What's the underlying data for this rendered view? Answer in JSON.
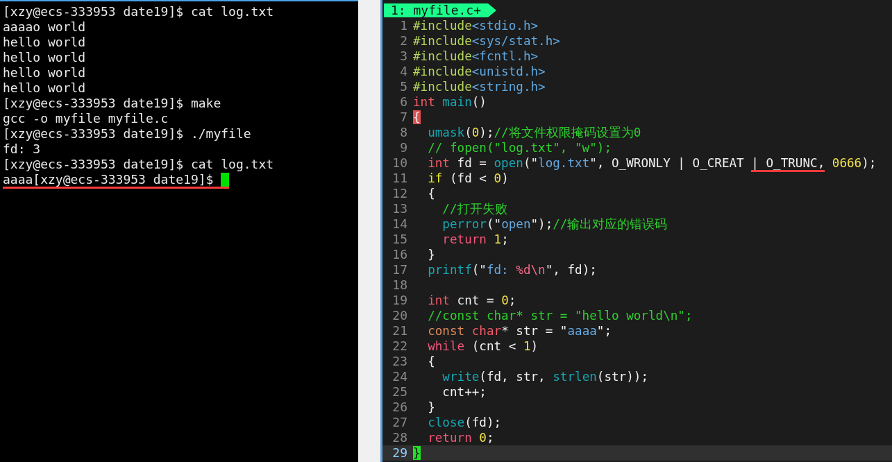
{
  "terminal": {
    "lines": [
      {
        "text": "[xzy@ecs-333953 date19]$ cat log.txt",
        "underlined": false,
        "cursor": false
      },
      {
        "text": "aaaao world",
        "underlined": false,
        "cursor": false
      },
      {
        "text": "hello world",
        "underlined": false,
        "cursor": false
      },
      {
        "text": "hello world",
        "underlined": false,
        "cursor": false
      },
      {
        "text": "hello world",
        "underlined": false,
        "cursor": false
      },
      {
        "text": "hello world",
        "underlined": false,
        "cursor": false
      },
      {
        "text": "[xzy@ecs-333953 date19]$ make",
        "underlined": false,
        "cursor": false
      },
      {
        "text": "gcc -o myfile myfile.c",
        "underlined": false,
        "cursor": false
      },
      {
        "text": "[xzy@ecs-333953 date19]$ ./myfile",
        "underlined": false,
        "cursor": false
      },
      {
        "text": "fd: 3",
        "underlined": false,
        "cursor": false
      },
      {
        "text": "[xzy@ecs-333953 date19]$ cat log.txt",
        "underlined": false,
        "cursor": false
      },
      {
        "text": "aaaa[xzy@ecs-333953 date19]$ ",
        "underlined": true,
        "cursor": true
      }
    ]
  },
  "editor": {
    "tabs": [
      {
        "label": "1: myfile.c+",
        "selected": true
      }
    ],
    "lines": [
      {
        "number": "1",
        "current": false,
        "tokens": [
          {
            "text": "#include",
            "kind": "preproc"
          },
          {
            "text": "<stdio.h>",
            "kind": "header"
          }
        ]
      },
      {
        "number": "2",
        "current": false,
        "tokens": [
          {
            "text": "#include",
            "kind": "preproc"
          },
          {
            "text": "<sys/stat.h>",
            "kind": "header"
          }
        ]
      },
      {
        "number": "3",
        "current": false,
        "tokens": [
          {
            "text": "#include",
            "kind": "preproc"
          },
          {
            "text": "<fcntl.h>",
            "kind": "header"
          }
        ]
      },
      {
        "number": "4",
        "current": false,
        "tokens": [
          {
            "text": "#include",
            "kind": "preproc"
          },
          {
            "text": "<unistd.h>",
            "kind": "header"
          }
        ]
      },
      {
        "number": "5",
        "current": false,
        "tokens": [
          {
            "text": "#include",
            "kind": "preproc"
          },
          {
            "text": "<string.h>",
            "kind": "header"
          }
        ]
      },
      {
        "number": "6",
        "current": false,
        "tokens": [
          {
            "text": "int",
            "kind": "type"
          },
          {
            "text": " main",
            "kind": "func"
          },
          {
            "text": "()",
            "kind": "plain"
          }
        ]
      },
      {
        "number": "7",
        "current": false,
        "tokens": [
          {
            "text": "{",
            "kind": "match"
          }
        ]
      },
      {
        "number": "8",
        "current": false,
        "tokens": [
          {
            "text": "  umask",
            "kind": "func"
          },
          {
            "text": "(",
            "kind": "plain"
          },
          {
            "text": "0",
            "kind": "number"
          },
          {
            "text": ");",
            "kind": "plain"
          },
          {
            "text": "//将文件权限掩码设置为0",
            "kind": "comment"
          }
        ]
      },
      {
        "number": "9",
        "current": false,
        "tokens": [
          {
            "text": "  // fopen(\"log.txt\", \"w\");",
            "kind": "comment"
          }
        ]
      },
      {
        "number": "10",
        "current": false,
        "tokens": [
          {
            "text": "  int",
            "kind": "type"
          },
          {
            "text": " fd = ",
            "kind": "plain"
          },
          {
            "text": "open",
            "kind": "func"
          },
          {
            "text": "(\"",
            "kind": "plain"
          },
          {
            "text": "log.txt",
            "kind": "string"
          },
          {
            "text": "\", O_WRONLY | O_CREAT ",
            "kind": "plain"
          },
          {
            "text": "| O_TRUNC,",
            "kind": "underlined"
          },
          {
            "text": " 0666",
            "kind": "number"
          },
          {
            "text": ");",
            "kind": "plain"
          }
        ]
      },
      {
        "number": "11",
        "current": false,
        "tokens": [
          {
            "text": "  if",
            "kind": "keyword"
          },
          {
            "text": " (fd < ",
            "kind": "plain"
          },
          {
            "text": "0",
            "kind": "number"
          },
          {
            "text": ")",
            "kind": "plain"
          }
        ]
      },
      {
        "number": "12",
        "current": false,
        "tokens": [
          {
            "text": "  {",
            "kind": "plain"
          }
        ]
      },
      {
        "number": "13",
        "current": false,
        "tokens": [
          {
            "text": "    //打开失败",
            "kind": "comment"
          }
        ]
      },
      {
        "number": "14",
        "current": false,
        "tokens": [
          {
            "text": "    perror",
            "kind": "func"
          },
          {
            "text": "(\"",
            "kind": "plain"
          },
          {
            "text": "open",
            "kind": "string"
          },
          {
            "text": "\");",
            "kind": "plain"
          },
          {
            "text": "//输出对应的错误码",
            "kind": "comment"
          }
        ]
      },
      {
        "number": "15",
        "current": false,
        "tokens": [
          {
            "text": "    return",
            "kind": "flow"
          },
          {
            "text": " 1",
            "kind": "number"
          },
          {
            "text": ";",
            "kind": "plain"
          }
        ]
      },
      {
        "number": "16",
        "current": false,
        "tokens": [
          {
            "text": "  }",
            "kind": "plain"
          }
        ]
      },
      {
        "number": "17",
        "current": false,
        "tokens": [
          {
            "text": "  printf",
            "kind": "func"
          },
          {
            "text": "(\"",
            "kind": "plain"
          },
          {
            "text": "fd: ",
            "kind": "string"
          },
          {
            "text": "%d\\n",
            "kind": "format"
          },
          {
            "text": "\", fd);",
            "kind": "plain"
          }
        ]
      },
      {
        "number": "18",
        "current": false
      },
      {
        "number": "19",
        "current": false,
        "tokens": [
          {
            "text": "  int",
            "kind": "type"
          },
          {
            "text": " cnt = ",
            "kind": "plain"
          },
          {
            "text": "0",
            "kind": "number"
          },
          {
            "text": ";",
            "kind": "plain"
          }
        ]
      },
      {
        "number": "20",
        "current": false,
        "tokens": [
          {
            "text": "  //const char* str = \"hello world\\n\";",
            "kind": "comment"
          }
        ]
      },
      {
        "number": "21",
        "current": false,
        "tokens": [
          {
            "text": "  const",
            "kind": "storage"
          },
          {
            "text": " char",
            "kind": "type"
          },
          {
            "text": "* str = \"",
            "kind": "plain"
          },
          {
            "text": "aaaa",
            "kind": "string"
          },
          {
            "text": "\";",
            "kind": "plain"
          }
        ]
      },
      {
        "number": "22",
        "current": false,
        "tokens": [
          {
            "text": "  while",
            "kind": "flow"
          },
          {
            "text": " (cnt < ",
            "kind": "plain"
          },
          {
            "text": "1",
            "kind": "number"
          },
          {
            "text": ")",
            "kind": "plain"
          }
        ]
      },
      {
        "number": "23",
        "current": false,
        "tokens": [
          {
            "text": "  {",
            "kind": "plain"
          }
        ]
      },
      {
        "number": "24",
        "current": false,
        "tokens": [
          {
            "text": "    write",
            "kind": "func"
          },
          {
            "text": "(fd, str, ",
            "kind": "plain"
          },
          {
            "text": "strlen",
            "kind": "func"
          },
          {
            "text": "(str));",
            "kind": "plain"
          }
        ]
      },
      {
        "number": "25",
        "current": false,
        "tokens": [
          {
            "text": "    cnt++;",
            "kind": "plain"
          }
        ]
      },
      {
        "number": "26",
        "current": false,
        "tokens": [
          {
            "text": "  }",
            "kind": "plain"
          }
        ]
      },
      {
        "number": "27",
        "current": false,
        "tokens": [
          {
            "text": "  close",
            "kind": "func"
          },
          {
            "text": "(fd);",
            "kind": "plain"
          }
        ]
      },
      {
        "number": "28",
        "current": false,
        "tokens": [
          {
            "text": "  return",
            "kind": "flow"
          },
          {
            "text": " 0",
            "kind": "number"
          },
          {
            "text": ";",
            "kind": "plain"
          }
        ]
      },
      {
        "number": "29",
        "current": true,
        "tokens": [
          {
            "text": "}",
            "kind": "cursor"
          }
        ]
      }
    ]
  }
}
